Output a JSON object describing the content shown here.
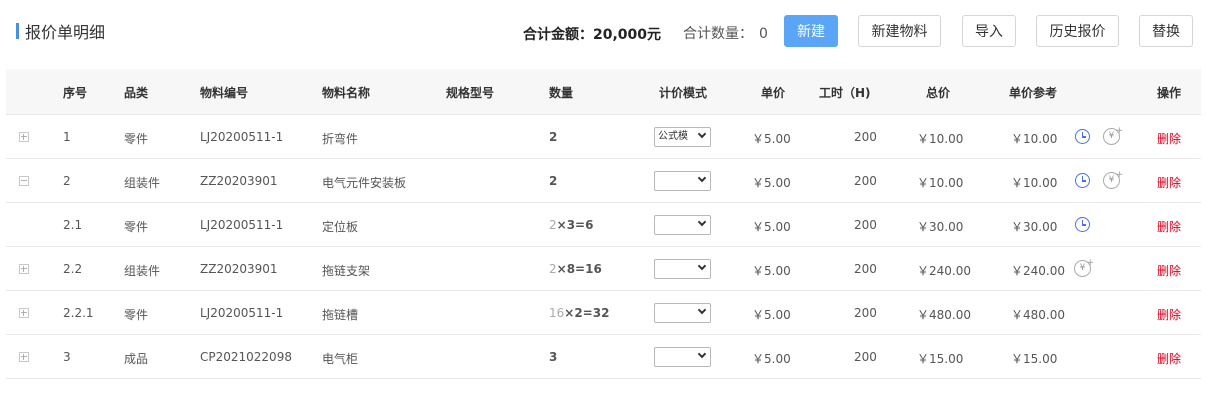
{
  "header": {
    "title": "报价单明细",
    "total_amount": "合计金额：20,000元",
    "total_qty_label": "合计数量：",
    "total_qty_value": "0",
    "buttons": {
      "new": "新建",
      "new_material": "新建物料",
      "import": "导入",
      "history": "历史报价",
      "replace": "替换"
    },
    "accent_color": "#5aa5f5"
  },
  "table": {
    "columns": [
      "序号",
      "品类",
      "物料编号",
      "物料名称",
      "规格型号",
      "数量",
      "计价模式",
      "单价",
      "工时（H)",
      "总价",
      "单价参考",
      "操作"
    ],
    "rows": [
      {
        "expander": "plus",
        "index": "1",
        "category": "零件",
        "code": "LJ20200511-1",
        "name": "折弯件",
        "qty_base": "",
        "qty": "2",
        "mode": "公式模",
        "price": "￥5.00",
        "hours": "200",
        "total": "￥10.00",
        "ref": "￥10.00",
        "clock": true,
        "yen": true,
        "action": "删除"
      },
      {
        "expander": "minus",
        "index": "2",
        "category": "组装件",
        "code": "ZZ20203901",
        "name": "电气元件安装板",
        "qty_base": "",
        "qty": "2",
        "mode": "",
        "price": "￥5.00",
        "hours": "200",
        "total": "￥10.00",
        "ref": "￥10.00",
        "clock": true,
        "yen": true,
        "action": "删除"
      },
      {
        "expander": "none",
        "index": "2.1",
        "category": "零件",
        "code": "LJ20200511-1",
        "name": "定位板",
        "qty_base": "2",
        "qty": "×3=6",
        "mode": "",
        "price": "￥5.00",
        "hours": "200",
        "total": "￥30.00",
        "ref": "￥30.00",
        "clock": true,
        "yen": false,
        "action": "删除"
      },
      {
        "expander": "plus",
        "index": "2.2",
        "category": "组装件",
        "code": "ZZ20203901",
        "name": "拖链支架",
        "qty_base": "2",
        "qty": "×8=16",
        "mode": "",
        "price": "￥5.00",
        "hours": "200",
        "total": "￥240.00",
        "ref": "￥240.00",
        "clock": false,
        "yen": true,
        "action": "删除"
      },
      {
        "expander": "plus",
        "index": "2.2.1",
        "category": "零件",
        "code": "LJ20200511-1",
        "name": "拖链槽",
        "qty_base": "16",
        "qty": "×2=32",
        "mode": "",
        "price": "￥5.00",
        "hours": "200",
        "total": "￥480.00",
        "ref": "￥480.00",
        "clock": false,
        "yen": false,
        "action": "删除"
      },
      {
        "expander": "plus",
        "index": "3",
        "category": "成品",
        "code": "CP2021022098",
        "name": "电气柜",
        "qty_base": "",
        "qty": "3",
        "mode": "",
        "price": "￥5.00",
        "hours": "200",
        "total": "￥15.00",
        "ref": "￥15.00",
        "clock": false,
        "yen": false,
        "action": "删除"
      }
    ],
    "icons": {
      "clock": "clock-icon",
      "yen": "yen-plus-icon"
    },
    "delete_color": "#d9001b"
  }
}
